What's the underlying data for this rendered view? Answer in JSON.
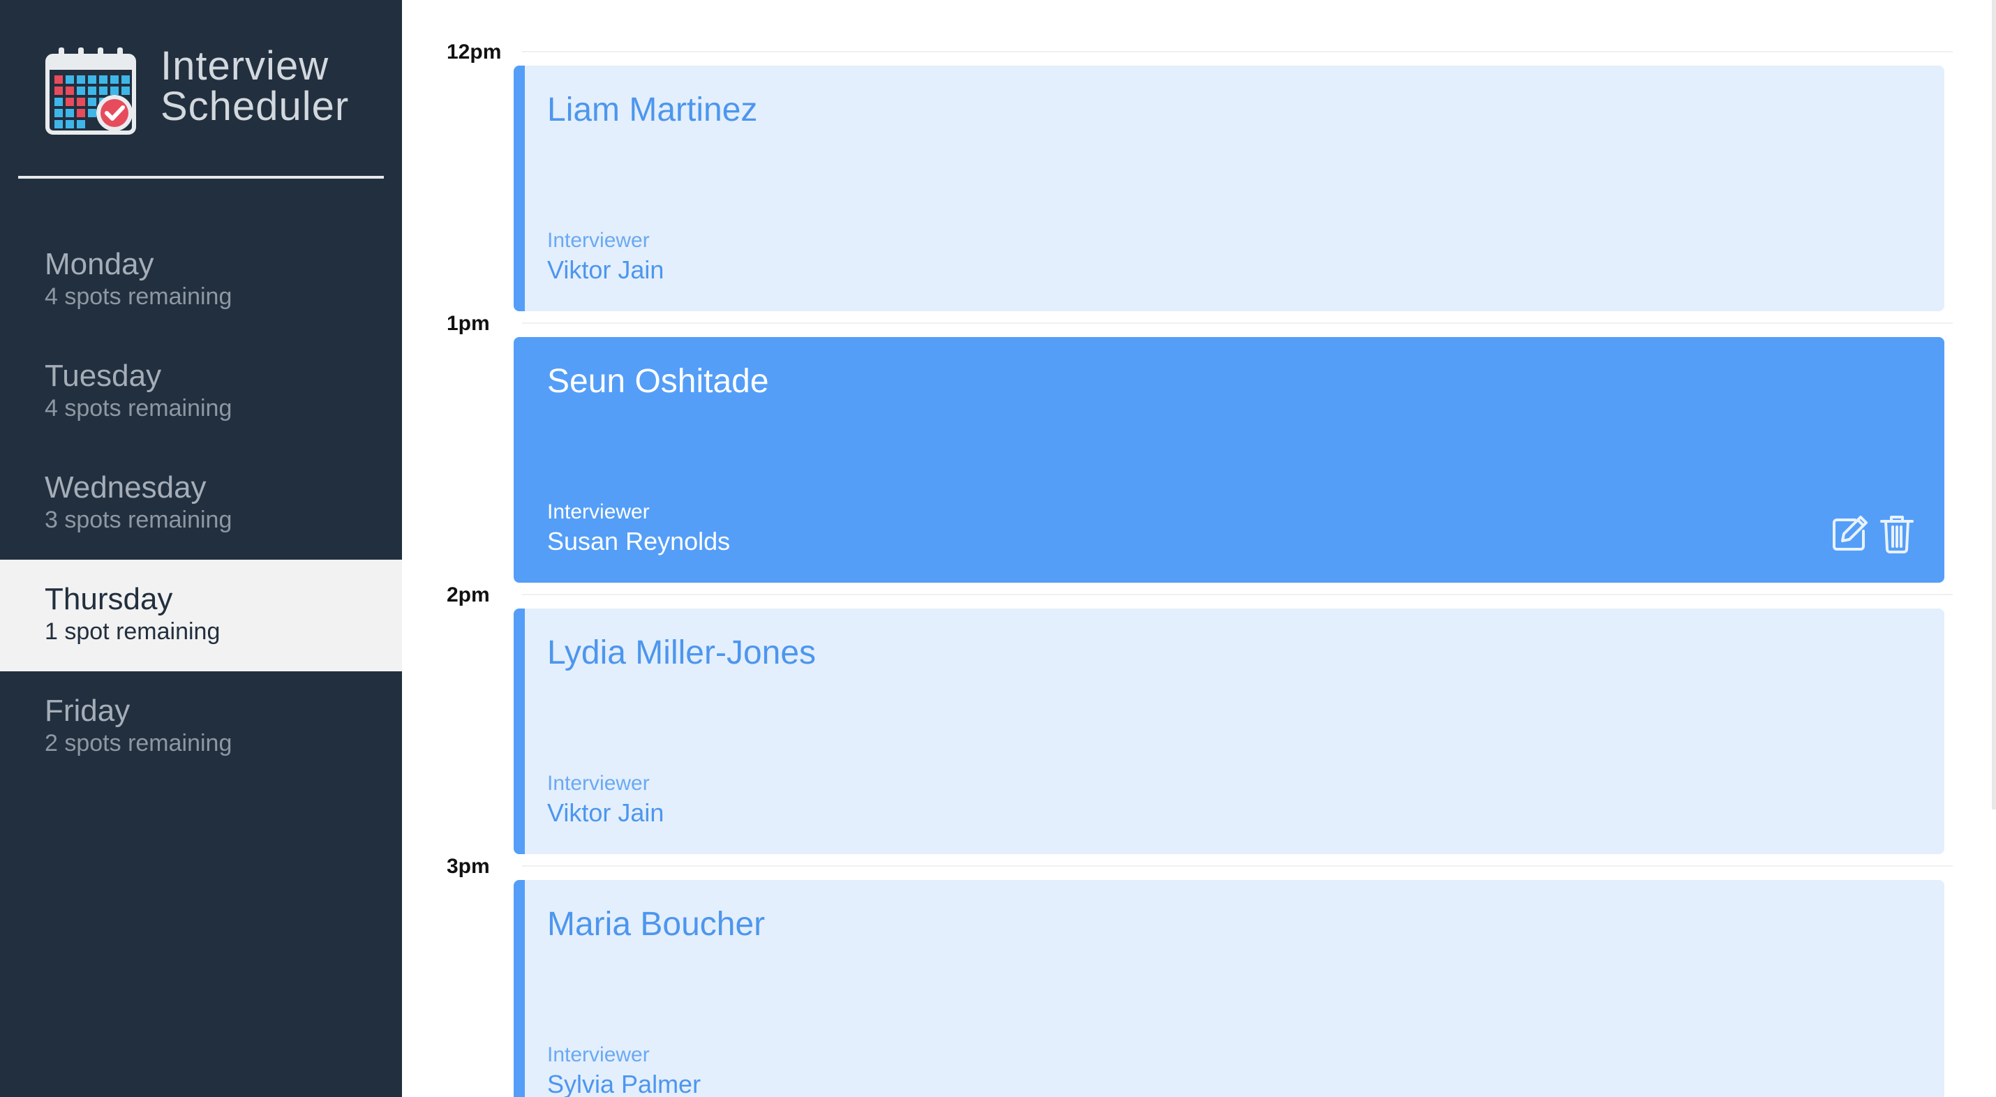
{
  "app": {
    "title_line1": "Interview",
    "title_line2": "Scheduler",
    "logo_icon": "calendar-check-icon"
  },
  "sidebar": {
    "days": [
      {
        "name": "Monday",
        "spots": "4 spots remaining",
        "selected": false
      },
      {
        "name": "Tuesday",
        "spots": "4 spots remaining",
        "selected": false
      },
      {
        "name": "Wednesday",
        "spots": "3 spots remaining",
        "selected": false
      },
      {
        "name": "Thursday",
        "spots": "1 spot remaining",
        "selected": true
      },
      {
        "name": "Friday",
        "spots": "2 spots remaining",
        "selected": false
      }
    ]
  },
  "schedule": {
    "slots": [
      {
        "time": "12pm",
        "student": "Liam Martinez",
        "interviewer_label": "Interviewer",
        "interviewer": "Viktor Jain",
        "active": false
      },
      {
        "time": "1pm",
        "student": "Seun Oshitade",
        "interviewer_label": "Interviewer",
        "interviewer": "Susan Reynolds",
        "active": true,
        "actions": [
          "edit-icon",
          "trash-icon"
        ]
      },
      {
        "time": "2pm",
        "student": "Lydia Miller-Jones",
        "interviewer_label": "Interviewer",
        "interviewer": "Viktor Jain",
        "active": false
      },
      {
        "time": "3pm",
        "student": "Maria Boucher",
        "interviewer_label": "Interviewer",
        "interviewer": "Sylvia Palmer",
        "active": false
      }
    ]
  },
  "colors": {
    "sidebar_bg": "#222f3e",
    "card_bg": "#e4effd",
    "accent": "#549ef8",
    "selected_day_bg": "#f2f2f2"
  }
}
